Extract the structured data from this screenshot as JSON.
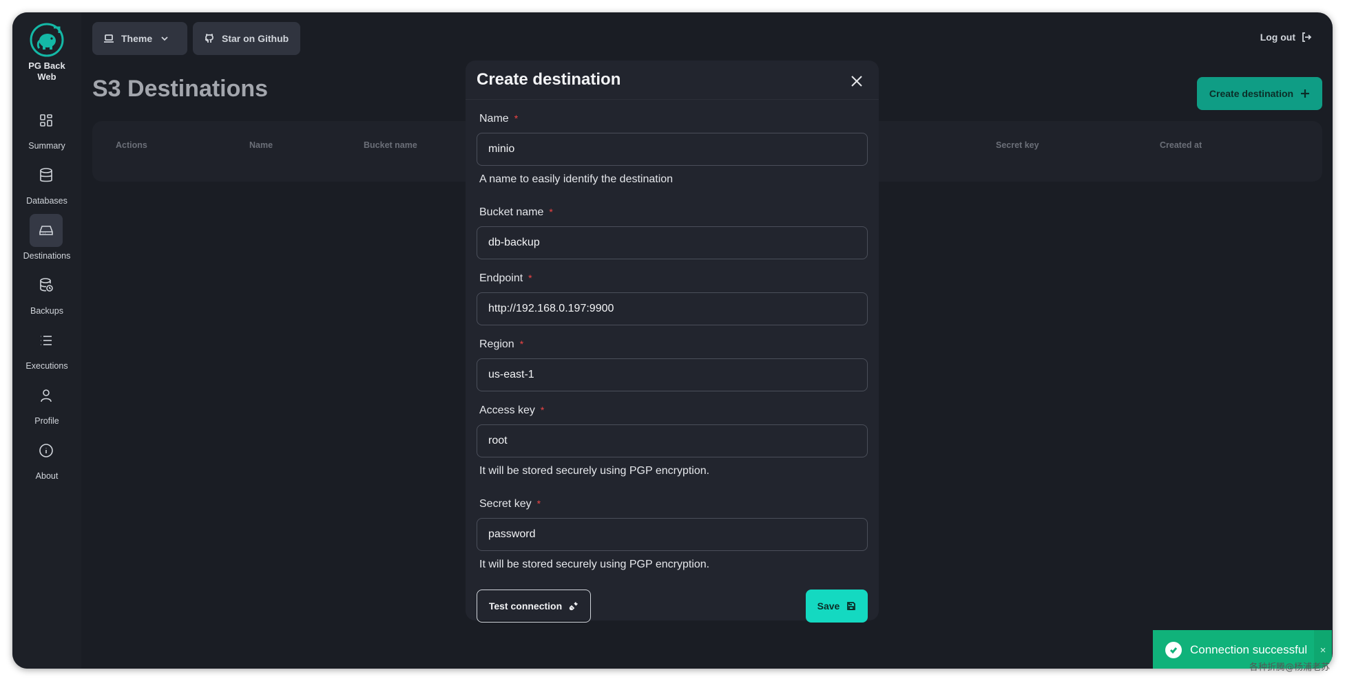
{
  "app": {
    "logo_text_line1": "PG Back",
    "logo_text_line2": "Web"
  },
  "sidebar": {
    "items": [
      {
        "label": "Summary",
        "icon": "grid-icon",
        "active": false
      },
      {
        "label": "Databases",
        "icon": "database-icon",
        "active": false
      },
      {
        "label": "Destinations",
        "icon": "hard-drive-icon",
        "active": true
      },
      {
        "label": "Backups",
        "icon": "database-backup-icon",
        "active": false
      },
      {
        "label": "Executions",
        "icon": "list-icon",
        "active": false
      },
      {
        "label": "Profile",
        "icon": "user-icon",
        "active": false
      },
      {
        "label": "About",
        "icon": "info-icon",
        "active": false
      }
    ]
  },
  "topbar": {
    "theme_label": "Theme",
    "github_label": "Star on Github",
    "logout_label": "Log out"
  },
  "page": {
    "title": "S3 Destinations",
    "create_label": "Create destination"
  },
  "table": {
    "headers": [
      "Actions",
      "Name",
      "Bucket name",
      "Secret key",
      "Created at"
    ]
  },
  "modal": {
    "title": "Create destination",
    "fields": {
      "name": {
        "label": "Name",
        "value": "minio",
        "help": "A name to easily identify the destination"
      },
      "bucket": {
        "label": "Bucket name",
        "value": "db-backup"
      },
      "endpoint": {
        "label": "Endpoint",
        "value": "http://192.168.0.197:9900"
      },
      "region": {
        "label": "Region",
        "value": "us-east-1"
      },
      "access_key": {
        "label": "Access key",
        "value": "root",
        "help": "It will be stored securely using PGP encryption."
      },
      "secret_key": {
        "label": "Secret key",
        "value": "password",
        "help": "It will be stored securely using PGP encryption."
      }
    },
    "required_mark": "*",
    "test_label": "Test connection",
    "save_label": "Save"
  },
  "toast": {
    "message": "Connection successful",
    "close": "×"
  },
  "watermark": "各种折腾@杨浦老苏",
  "colors": {
    "accent": "#14d9c1",
    "accent_dark": "#0f9d85",
    "success": "#10b27a",
    "required": "#ef4444",
    "background": "#1a1d24"
  }
}
